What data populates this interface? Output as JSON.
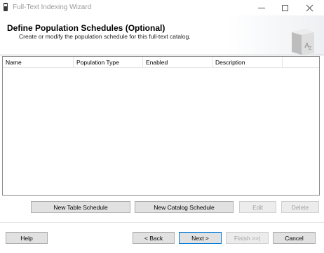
{
  "window": {
    "title": "Full-Text Indexing Wizard"
  },
  "header": {
    "title": "Define Population Schedules (Optional)",
    "subtitle": "Create or modify the population schedule for this full-text catalog."
  },
  "icons": {
    "app": "app-icon",
    "minimize": "minimize-icon",
    "maximize": "maximize-icon",
    "close": "close-icon",
    "wizard": "book-az-icon"
  },
  "table": {
    "columns": [
      "Name",
      "Population Type",
      "Enabled",
      "Description"
    ],
    "rows": []
  },
  "schedule_buttons": {
    "new_table": "New Table Schedule",
    "new_catalog": "New Catalog Schedule",
    "edit": "Edit",
    "delete": "Delete"
  },
  "nav_buttons": {
    "help": "Help",
    "back": "< Back",
    "next": "Next >",
    "finish": "Finish >>|",
    "cancel": "Cancel"
  },
  "colors": {
    "focus_border": "#0078d7",
    "disabled_text": "#a0a0a0",
    "button_face": "#e1e1e1"
  }
}
